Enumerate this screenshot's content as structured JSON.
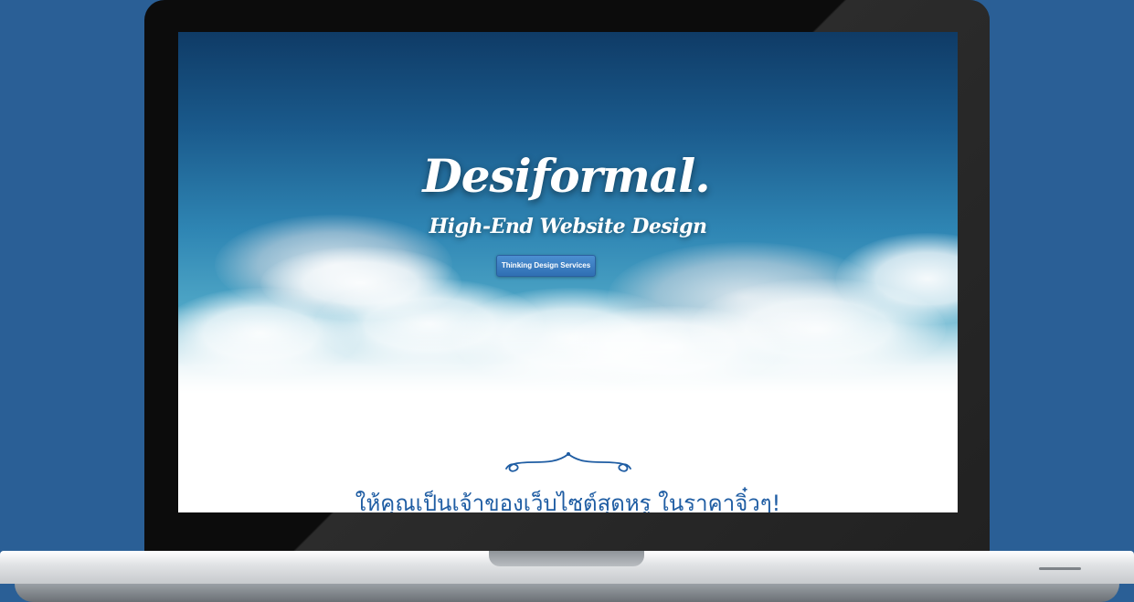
{
  "brand": {
    "name": "Desiformal.",
    "tagline": "High-End Website Design"
  },
  "hero": {
    "cta_label": "Thinking Design Services"
  },
  "section": {
    "heading": "ให้คุณเป็นเจ้าของเว็บไซต์สุดหรู ในราคาจิ๋วๆ!"
  },
  "colors": {
    "page_background": "#2a5f96",
    "sky_top": "#0f3b66",
    "sky_mid": "#2f86b4",
    "button": "#3a7cc2",
    "heading_text": "#1f5da3"
  }
}
